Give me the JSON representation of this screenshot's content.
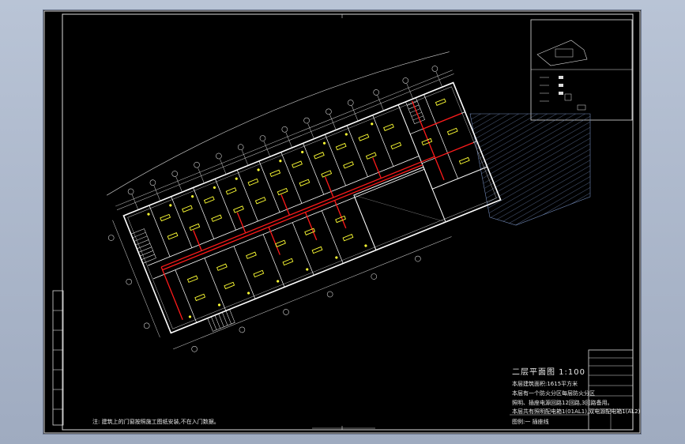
{
  "drawing": {
    "title_label": "二层平面图 1:100",
    "notes": [
      "本层建筑面积:1615平方米",
      "本层有一个防火分区每层防火分区",
      "照明、插座电源回路12回路,3回路备用。",
      "本层共有照明配电箱1(01AL1),双电源配电箱1(AL2)"
    ],
    "sheet_note": "注: 建筑上的门窗按照施工图纸安装,不在入门数据。",
    "footer_note": "图例:一 插座线"
  },
  "colors": {
    "background": "#000000",
    "wall": "#ffffff",
    "circuit": "#ff1a1a",
    "fixture": "#ffff33",
    "hatch": "#6f86b3",
    "dimension": "#cfcfcf"
  }
}
